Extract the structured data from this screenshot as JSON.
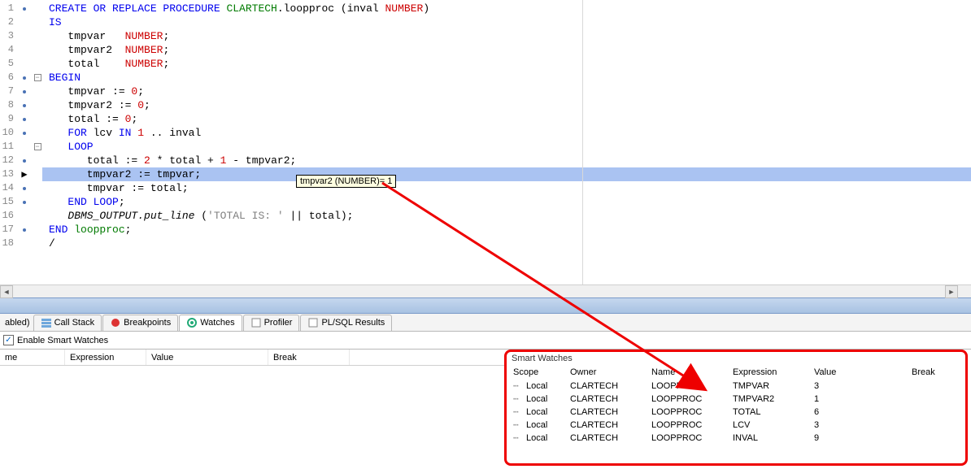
{
  "editor": {
    "lines": [
      {
        "num": "1",
        "marker": "dot",
        "fold": "",
        "content": [
          [
            "kw",
            "CREATE OR REPLACE PROCEDURE"
          ],
          [
            "",
            " "
          ],
          [
            "ident",
            "CLARTECH"
          ],
          [
            "",
            ".loopproc (inval "
          ],
          [
            "type",
            "NUMBER"
          ],
          [
            "",
            ")"
          ]
        ]
      },
      {
        "num": "2",
        "marker": "",
        "fold": "",
        "content": [
          [
            "kw",
            "IS"
          ]
        ]
      },
      {
        "num": "3",
        "marker": "",
        "fold": "",
        "content": [
          [
            "",
            "   tmpvar   "
          ],
          [
            "type",
            "NUMBER"
          ],
          [
            "",
            ";"
          ]
        ]
      },
      {
        "num": "4",
        "marker": "",
        "fold": "",
        "content": [
          [
            "",
            "   tmpvar2  "
          ],
          [
            "type",
            "NUMBER"
          ],
          [
            "",
            ";"
          ]
        ]
      },
      {
        "num": "5",
        "marker": "",
        "fold": "",
        "content": [
          [
            "",
            "   total    "
          ],
          [
            "type",
            "NUMBER"
          ],
          [
            "",
            ";"
          ]
        ]
      },
      {
        "num": "6",
        "marker": "dot",
        "fold": "minus",
        "content": [
          [
            "kw",
            "BEGIN"
          ]
        ]
      },
      {
        "num": "7",
        "marker": "dot",
        "fold": "",
        "content": [
          [
            "",
            "   tmpvar := "
          ],
          [
            "num",
            "0"
          ],
          [
            "",
            ";"
          ]
        ]
      },
      {
        "num": "8",
        "marker": "dot",
        "fold": "",
        "content": [
          [
            "",
            "   tmpvar2 := "
          ],
          [
            "num",
            "0"
          ],
          [
            "",
            ";"
          ]
        ]
      },
      {
        "num": "9",
        "marker": "dot",
        "fold": "",
        "content": [
          [
            "",
            "   total := "
          ],
          [
            "num",
            "0"
          ],
          [
            "",
            ";"
          ]
        ]
      },
      {
        "num": "10",
        "marker": "dot",
        "fold": "",
        "content": [
          [
            "",
            "   "
          ],
          [
            "kw",
            "FOR"
          ],
          [
            "",
            " lcv "
          ],
          [
            "kw",
            "IN"
          ],
          [
            "",
            " "
          ],
          [
            "num",
            "1"
          ],
          [
            "",
            " .. inval"
          ]
        ]
      },
      {
        "num": "11",
        "marker": "",
        "fold": "minus",
        "content": [
          [
            "",
            "   "
          ],
          [
            "kw",
            "LOOP"
          ]
        ]
      },
      {
        "num": "12",
        "marker": "dot",
        "fold": "",
        "content": [
          [
            "",
            "      total := "
          ],
          [
            "num",
            "2"
          ],
          [
            "",
            " * total + "
          ],
          [
            "num",
            "1"
          ],
          [
            "",
            " - tmpvar2;"
          ]
        ]
      },
      {
        "num": "13",
        "marker": "arrow",
        "fold": "",
        "hl": true,
        "content": [
          [
            "",
            "      tmpvar2 := tmpvar;"
          ]
        ]
      },
      {
        "num": "14",
        "marker": "dot",
        "fold": "",
        "content": [
          [
            "",
            "      tmpvar := total;"
          ]
        ]
      },
      {
        "num": "15",
        "marker": "dot",
        "fold": "",
        "content": [
          [
            "",
            "   "
          ],
          [
            "kw",
            "END LOOP"
          ],
          [
            "",
            ";"
          ]
        ]
      },
      {
        "num": "16",
        "marker": "",
        "fold": "",
        "content": [
          [
            "ital",
            "   DBMS_OUTPUT.put_line "
          ],
          [
            "",
            "("
          ],
          [
            "str",
            "'TOTAL IS: '"
          ],
          [
            "",
            " || total);"
          ]
        ]
      },
      {
        "num": "17",
        "marker": "dot",
        "fold": "",
        "content": [
          [
            "kw",
            "END"
          ],
          [
            "",
            " "
          ],
          [
            "ident",
            "loopproc"
          ],
          [
            "",
            ";"
          ]
        ]
      },
      {
        "num": "18",
        "marker": "",
        "fold": "",
        "content": [
          [
            "",
            "/"
          ]
        ]
      }
    ]
  },
  "tooltip": "tmpvar2 (NUMBER)= 1",
  "tabs": {
    "t0": "abled)",
    "t1": "Call Stack",
    "t2": "Breakpoints",
    "t3": "Watches",
    "t4": "Profiler",
    "t5": "PL/SQL Results"
  },
  "enable_smart_watches": "Enable Smart Watches",
  "left_headers": {
    "c0": "me",
    "c1": "Expression",
    "c2": "Value",
    "c3": "Break"
  },
  "smart_watches": {
    "title": "Smart Watches",
    "headers": {
      "scope": "Scope",
      "owner": "Owner",
      "name": "Name",
      "expr": "Expression",
      "value": "Value",
      "brk": "Break"
    },
    "rows": [
      {
        "scope": "Local",
        "owner": "CLARTECH",
        "name": "LOOPPROC",
        "expr": "TMPVAR",
        "value": "3",
        "brk": ""
      },
      {
        "scope": "Local",
        "owner": "CLARTECH",
        "name": "LOOPPROC",
        "expr": "TMPVAR2",
        "value": "1",
        "brk": ""
      },
      {
        "scope": "Local",
        "owner": "CLARTECH",
        "name": "LOOPPROC",
        "expr": "TOTAL",
        "value": "6",
        "brk": ""
      },
      {
        "scope": "Local",
        "owner": "CLARTECH",
        "name": "LOOPPROC",
        "expr": "LCV",
        "value": "3",
        "brk": ""
      },
      {
        "scope": "Local",
        "owner": "CLARTECH",
        "name": "LOOPPROC",
        "expr": "INVAL",
        "value": "9",
        "brk": ""
      }
    ]
  }
}
